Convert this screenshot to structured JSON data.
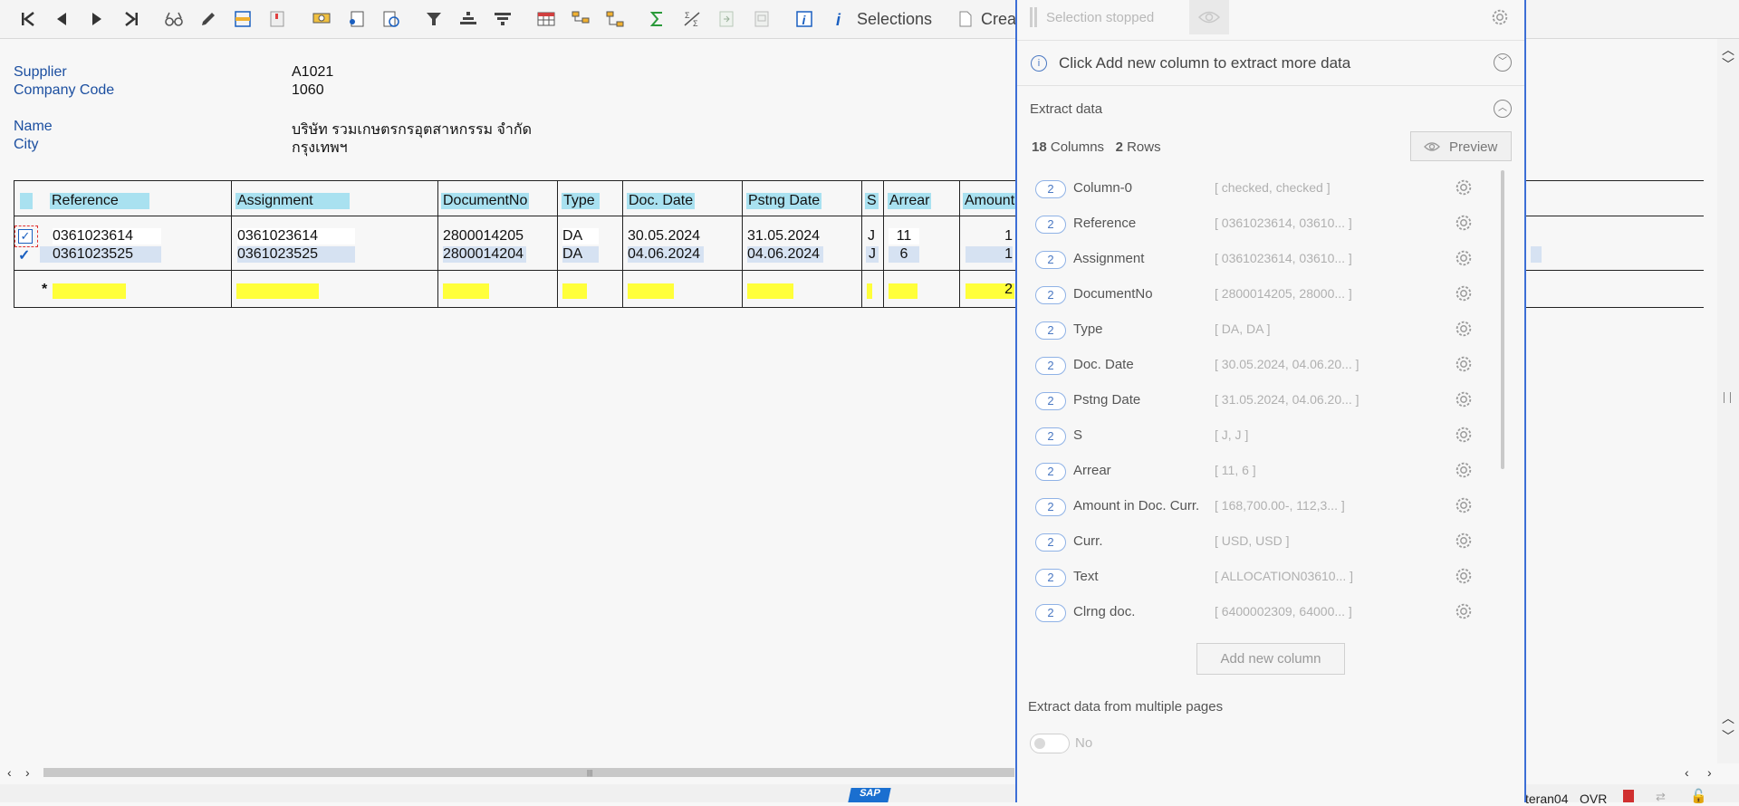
{
  "toolbar": {
    "selections_label": "Selections",
    "create_label": "Crea"
  },
  "header": {
    "supplier_label": "Supplier",
    "supplier_value": "A1021",
    "company_label": "Company Code",
    "company_value": "1060",
    "name_label": "Name",
    "name_value": "บริษัท รวมเกษตรกรอุตสาหกรรม จำกัด",
    "city_label": "City",
    "city_value": "กรุงเทพฯ"
  },
  "table": {
    "columns": [
      "Reference",
      "Assignment",
      "DocumentNo",
      "Type",
      "Doc. Date",
      "Pstng Date",
      "S",
      "Arrear",
      "Amount"
    ],
    "rows": [
      {
        "reference": "0361023614",
        "assignment": "0361023614",
        "docno": "2800014205",
        "type": "DA",
        "doc_date": "30.05.2024",
        "pstng_date": "31.05.2024",
        "s": "J",
        "arrear": "11",
        "amount": "1"
      },
      {
        "reference": "0361023525",
        "assignment": "0361023525",
        "docno": "2800014204",
        "type": "DA",
        "doc_date": "04.06.2024",
        "pstng_date": "04.06.2024",
        "s": "J",
        "arrear": "6",
        "amount": "1"
      }
    ],
    "total_marker": "*",
    "total_amount": "2"
  },
  "status": {
    "user_fragment": "teran04",
    "mode": "OVR"
  },
  "panel": {
    "selection_status": "Selection stopped",
    "info_text": "Click Add new column to extract more data",
    "section_title": "Extract data",
    "columns_count": "18",
    "columns_label": "Columns",
    "rows_count": "2",
    "rows_label": "Rows",
    "preview_label": "Preview",
    "columns": [
      {
        "badge": "2",
        "name": "Column-0",
        "sample": "[ checked, checked ]"
      },
      {
        "badge": "2",
        "name": "Reference",
        "sample": "[ 0361023614, 03610... ]"
      },
      {
        "badge": "2",
        "name": "Assignment",
        "sample": "[ 0361023614, 03610... ]"
      },
      {
        "badge": "2",
        "name": "DocumentNo",
        "sample": "[ 2800014205, 28000... ]"
      },
      {
        "badge": "2",
        "name": "Type",
        "sample": "[ DA, DA ]"
      },
      {
        "badge": "2",
        "name": "Doc. Date",
        "sample": "[ 30.05.2024, 04.06.20... ]"
      },
      {
        "badge": "2",
        "name": "Pstng Date",
        "sample": "[ 31.05.2024, 04.06.20... ]"
      },
      {
        "badge": "2",
        "name": "S",
        "sample": "[ J, J ]"
      },
      {
        "badge": "2",
        "name": "Arrear",
        "sample": "[ 11, 6 ]"
      },
      {
        "badge": "2",
        "name": "Amount in Doc. Curr.",
        "sample": "[ 168,700.00-, 112,3... ]"
      },
      {
        "badge": "2",
        "name": "Curr.",
        "sample": "[ USD, USD ]"
      },
      {
        "badge": "2",
        "name": "Text",
        "sample": "[ ALLOCATION03610... ]"
      },
      {
        "badge": "2",
        "name": "Clrng doc.",
        "sample": "[ 6400002309, 64000... ]"
      }
    ],
    "add_column_label": "Add new column",
    "multi_page_label": "Extract data from multiple pages",
    "toggle_value": "No"
  },
  "colors": {
    "header_bg": "#a9e1f0",
    "total_yellow": "#ffff3a",
    "label_blue": "#1c4fa0",
    "panel_border": "#3d6fd6"
  }
}
